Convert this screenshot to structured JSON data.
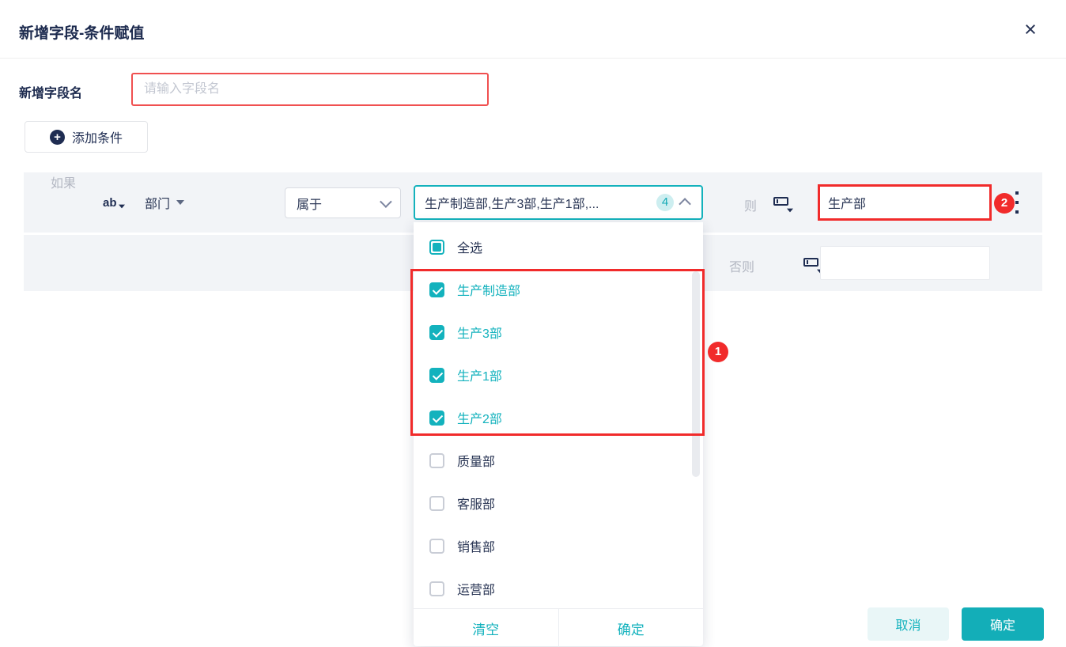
{
  "dialog": {
    "title": "新增字段-条件赋值",
    "close_glyph": "×",
    "field_name": {
      "label": "新增字段名",
      "placeholder": "请输入字段名"
    },
    "add_condition": {
      "icon": "+",
      "label": "添加条件"
    },
    "footer": {
      "cancel": "取消",
      "confirm": "确定"
    }
  },
  "condition": {
    "if_label": "如果",
    "field_type_icon": "ab",
    "field": "部门",
    "operator": "属于",
    "values_display": "生产制造部,生产3部,生产1部,...",
    "values_count": "4",
    "then_label": "则",
    "then_value": "生产部",
    "else_label": "否则",
    "else_value": ""
  },
  "dropdown": {
    "select_all": "全选",
    "items": [
      {
        "label": "生产制造部",
        "checked": true
      },
      {
        "label": "生产3部",
        "checked": true
      },
      {
        "label": "生产1部",
        "checked": true
      },
      {
        "label": "生产2部",
        "checked": true
      },
      {
        "label": "质量部",
        "checked": false
      },
      {
        "label": "客服部",
        "checked": false
      },
      {
        "label": "销售部",
        "checked": false
      },
      {
        "label": "运营部",
        "checked": false
      }
    ],
    "clear": "清空",
    "confirm": "确定"
  },
  "annotations": {
    "step1": "1",
    "step2": "2"
  },
  "colors": {
    "accent_teal": "#13b2bd",
    "navy_text": "#1f2d52",
    "annotation_red": "#f12b2b",
    "row_bg": "#f2f4f7"
  }
}
